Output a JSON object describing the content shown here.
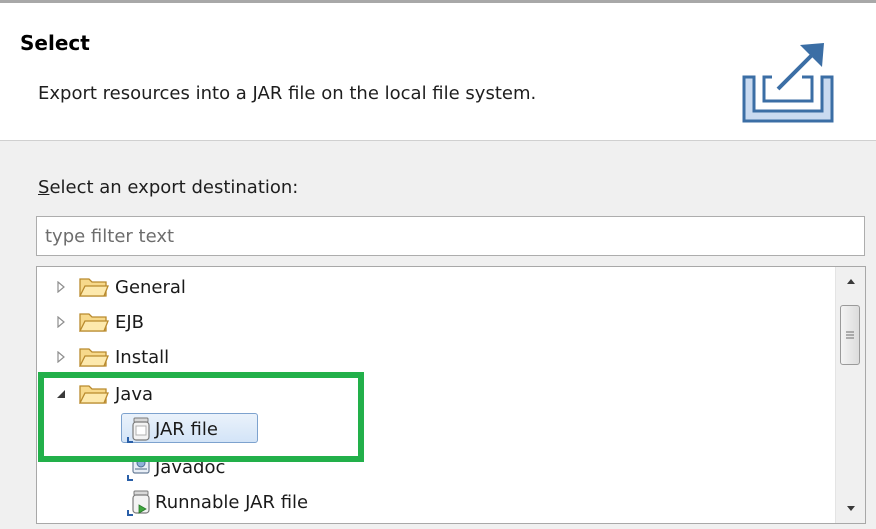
{
  "header": {
    "title": "Select",
    "description": "Export resources into a JAR file on the local file system."
  },
  "body": {
    "label_prefix": "S",
    "label_rest": "elect an export destination:",
    "filter_placeholder": "type filter text"
  },
  "tree": {
    "items": [
      {
        "label": "General",
        "icon": "folder-icon",
        "expanded": false
      },
      {
        "label": "EJB",
        "icon": "folder-icon",
        "expanded": false
      },
      {
        "label": "Install",
        "icon": "folder-icon",
        "expanded": false
      },
      {
        "label": "Java",
        "icon": "folder-icon",
        "expanded": true
      },
      {
        "label": "JAR file",
        "icon": "jar-icon",
        "selected": true
      },
      {
        "label": "Javadoc",
        "icon": "javadoc-icon"
      },
      {
        "label": "Runnable JAR file",
        "icon": "runnable-jar-icon"
      }
    ]
  },
  "colors": {
    "highlight": "#22b04a",
    "selection_border": "#7da2ce",
    "folder": "#f5c35b"
  }
}
